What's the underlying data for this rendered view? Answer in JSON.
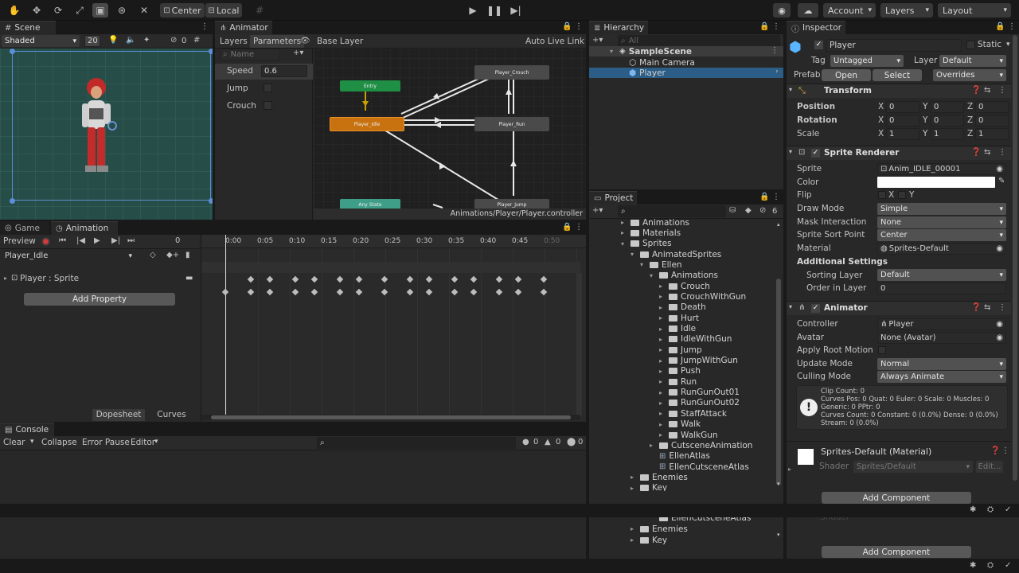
{
  "toolbar": {
    "pivot_label": "Center",
    "space_label": "Local",
    "account_label": "Account",
    "layers_label": "Layers",
    "layout_label": "Layout"
  },
  "scene": {
    "tab_label": "Scene",
    "shading_mode": "Shaded",
    "grid_size": "20",
    "hidden_count": "0"
  },
  "animator": {
    "tab_label": "Animator",
    "layers_tab": "Layers",
    "parameters_tab": "Parameters",
    "breadcrumb": "Base Layer",
    "auto_live_link": "Auto Live Link",
    "search_placeholder": "Name",
    "parameters": [
      {
        "name": "Speed",
        "value": "0.6"
      },
      {
        "name": "Jump",
        "value": ""
      },
      {
        "name": "Crouch",
        "value": ""
      }
    ],
    "states": {
      "entry": "Entry",
      "idle": "Player_Idle",
      "run": "Player_Run",
      "crouch": "Player_Crouch",
      "jump": "Player_Jump",
      "any": "Any State"
    },
    "colors": {
      "entry": "#1f8f45",
      "default_state": "#c8710f",
      "state": "#4a4a4a",
      "any": "#3e9e87"
    },
    "controller_path": "Animations/Player/Player.controller"
  },
  "animation": {
    "game_tab": "Game",
    "animation_tab": "Animation",
    "preview_label": "Preview",
    "frame_value": "0",
    "clip_name": "Player_Idle",
    "property_label": "Player : Sprite",
    "add_property": "Add Property",
    "dopesheet_tab": "Dopesheet",
    "curves_tab": "Curves",
    "ruler": [
      "0:00",
      "0:05",
      "0:10",
      "0:15",
      "0:20",
      "0:25",
      "0:30",
      "0:35",
      "0:40",
      "0:45",
      "0:50"
    ]
  },
  "console": {
    "tab_label": "Console",
    "clear": "Clear",
    "collapse": "Collapse",
    "error_pause": "Error Pause",
    "editor": "Editor",
    "log_count": "0",
    "warn_count": "0",
    "error_count": "0"
  },
  "hierarchy": {
    "tab_label": "Hierarchy",
    "search_placeholder": "All",
    "scene_name": "SampleScene",
    "items": [
      "Main Camera",
      "Player"
    ]
  },
  "project": {
    "tab_label": "Project",
    "hidden_count": "6",
    "tree": [
      {
        "label": "Animations",
        "depth": 0,
        "type": "folder",
        "expanded": false
      },
      {
        "label": "Materials",
        "depth": 0,
        "type": "folder",
        "expanded": false
      },
      {
        "label": "Sprites",
        "depth": 0,
        "type": "folder",
        "expanded": true
      },
      {
        "label": "AnimatedSprites",
        "depth": 1,
        "type": "folder",
        "expanded": true
      },
      {
        "label": "Ellen",
        "depth": 2,
        "type": "folder",
        "expanded": true
      },
      {
        "label": "Animations",
        "depth": 3,
        "type": "folder",
        "expanded": true
      },
      {
        "label": "Crouch",
        "depth": 4,
        "type": "folder",
        "expanded": false
      },
      {
        "label": "CrouchWithGun",
        "depth": 4,
        "type": "folder",
        "expanded": false
      },
      {
        "label": "Death",
        "depth": 4,
        "type": "folder",
        "expanded": false
      },
      {
        "label": "Hurt",
        "depth": 4,
        "type": "folder",
        "expanded": false
      },
      {
        "label": "Idle",
        "depth": 4,
        "type": "folder",
        "expanded": false
      },
      {
        "label": "IdleWithGun",
        "depth": 4,
        "type": "folder",
        "expanded": false
      },
      {
        "label": "Jump",
        "depth": 4,
        "type": "folder",
        "expanded": false
      },
      {
        "label": "JumpWithGun",
        "depth": 4,
        "type": "folder",
        "expanded": false
      },
      {
        "label": "Push",
        "depth": 4,
        "type": "folder",
        "expanded": false
      },
      {
        "label": "Run",
        "depth": 4,
        "type": "folder",
        "expanded": false
      },
      {
        "label": "RunGunOut01",
        "depth": 4,
        "type": "folder",
        "expanded": false
      },
      {
        "label": "RunGunOut02",
        "depth": 4,
        "type": "folder",
        "expanded": false
      },
      {
        "label": "StaffAttack",
        "depth": 4,
        "type": "folder",
        "expanded": false
      },
      {
        "label": "Walk",
        "depth": 4,
        "type": "folder",
        "expanded": false
      },
      {
        "label": "WalkGun",
        "depth": 4,
        "type": "folder",
        "expanded": false
      },
      {
        "label": "CutsceneAnimation",
        "depth": 3,
        "type": "folder",
        "expanded": false
      },
      {
        "label": "EllenAtlas",
        "depth": 3,
        "type": "asset",
        "expanded": false
      },
      {
        "label": "EllenCutsceneAtlas",
        "depth": 3,
        "type": "asset",
        "expanded": false
      },
      {
        "label": "Enemies",
        "depth": 1,
        "type": "folder",
        "expanded": false
      },
      {
        "label": "Key",
        "depth": 1,
        "type": "folder",
        "expanded": false
      }
    ],
    "ghost_tree": [
      {
        "label": "EllenCutsceneAtlas",
        "depth": 3
      },
      {
        "label": "Enemies",
        "depth": 1
      },
      {
        "label": "Key",
        "depth": 1
      }
    ]
  },
  "inspector": {
    "tab_label": "Inspector",
    "object_name": "Player",
    "static_label": "Static",
    "tag_label": "Tag",
    "tag_value": "Untagged",
    "layer_label": "Layer",
    "layer_value": "Default",
    "prefab_label": "Prefab",
    "prefab_open": "Open",
    "prefab_select": "Select",
    "prefab_overrides": "Overrides",
    "transform": {
      "title": "Transform",
      "rows": [
        {
          "label": "Position",
          "x": "0",
          "y": "0",
          "z": "0"
        },
        {
          "label": "Rotation",
          "x": "0",
          "y": "0",
          "z": "0"
        },
        {
          "label": "Scale",
          "x": "1",
          "y": "1",
          "z": "1"
        }
      ]
    },
    "sprite_renderer": {
      "title": "Sprite Renderer",
      "sprite_label": "Sprite",
      "sprite_value": "Anim_IDLE_00001",
      "color_label": "Color",
      "flip_label": "Flip",
      "flip_x": "X",
      "flip_y": "Y",
      "draw_mode_label": "Draw Mode",
      "draw_mode_value": "Simple",
      "mask_label": "Mask Interaction",
      "mask_value": "None",
      "sort_point_label": "Sprite Sort Point",
      "sort_point_value": "Center",
      "material_label": "Material",
      "material_value": "Sprites-Default",
      "additional_label": "Additional Settings",
      "sorting_layer_label": "Sorting Layer",
      "sorting_layer_value": "Default",
      "order_label": "Order in Layer",
      "order_value": "0"
    },
    "animator": {
      "title": "Animator",
      "controller_label": "Controller",
      "controller_value": "Player",
      "avatar_label": "Avatar",
      "avatar_value": "None (Avatar)",
      "root_motion_label": "Apply Root Motion",
      "update_mode_label": "Update Mode",
      "update_mode_value": "Normal",
      "culling_label": "Culling Mode",
      "culling_value": "Always Animate",
      "info_lines": [
        "Clip Count: 0",
        "Curves Pos: 0 Quat: 0 Euler: 0 Scale: 0 Muscles: 0",
        "Generic: 0 PPtr: 0",
        "Curves Count: 0 Constant: 0 (0.0%) Dense: 0 (0.0%)",
        "Stream: 0 (0.0%)"
      ]
    },
    "material": {
      "title": "Sprites-Default (Material)",
      "shader_label": "Shader",
      "shader_value": "Sprites/Default",
      "edit_label": "Edit..."
    },
    "add_component": "Add Component"
  }
}
